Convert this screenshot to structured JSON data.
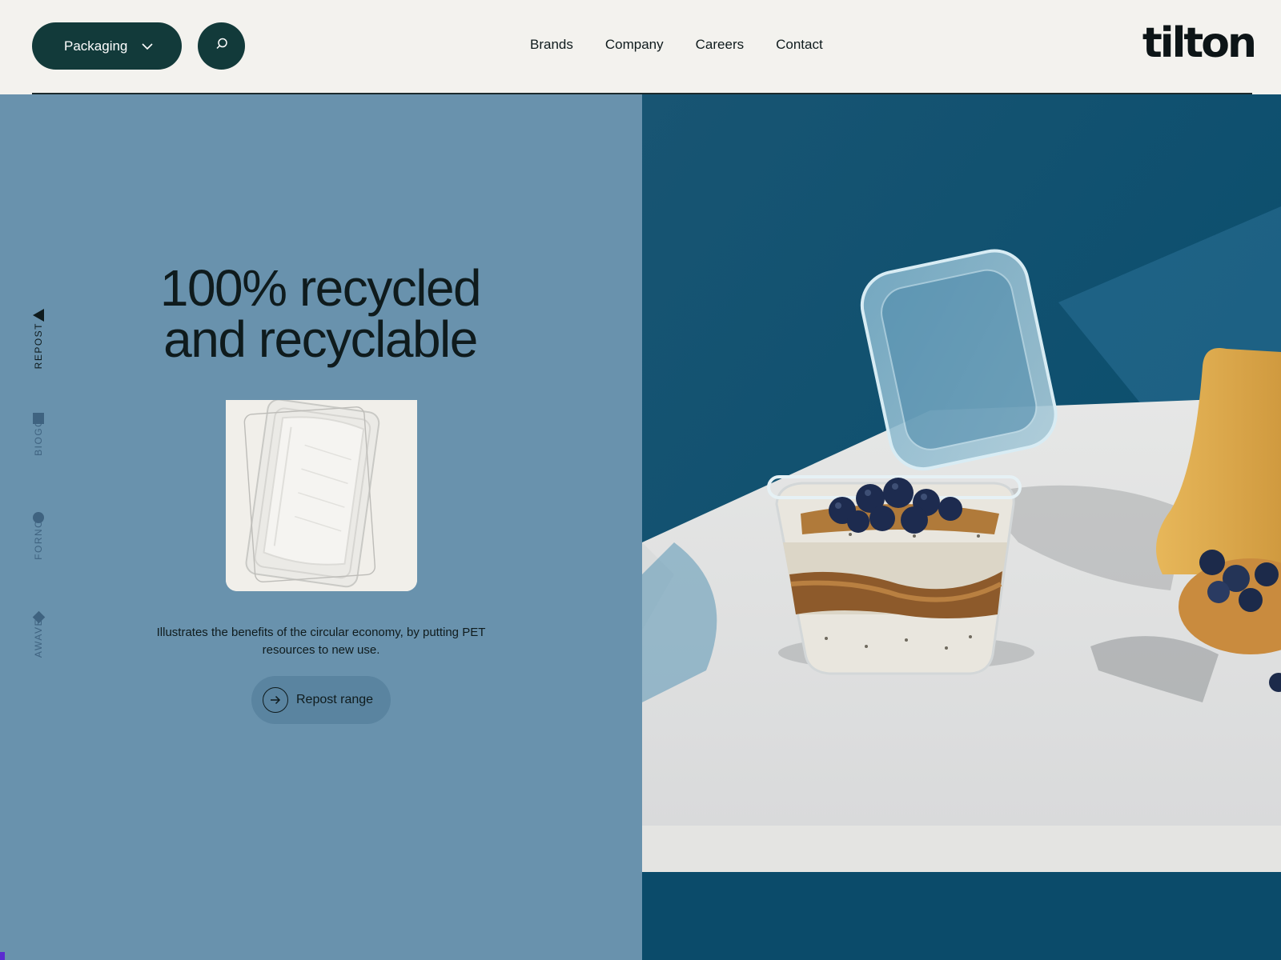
{
  "header": {
    "category_label": "Packaging",
    "nav": [
      "Brands",
      "Company",
      "Careers",
      "Contact"
    ],
    "logo_text": "tilton"
  },
  "sidebar": {
    "items": [
      {
        "label": "REPOST",
        "shape": "triangle",
        "active": true
      },
      {
        "label": "BIOGO",
        "shape": "square",
        "active": false
      },
      {
        "label": "FORNO",
        "shape": "circle",
        "active": false
      },
      {
        "label": "AWAVE",
        "shape": "diamond",
        "active": false
      }
    ]
  },
  "hero": {
    "headline_line1": "100% recycled",
    "headline_line2": "and recyclable",
    "description": "Illustrates the benefits of the circular economy, by putting PET resources to new use.",
    "cta_label": "Repost range"
  },
  "colors": {
    "panel_blue": "#6992ad",
    "dark_green": "#123a3a",
    "photo_bg": "#0f5576"
  },
  "icons": {
    "chevron": "chevron-down-icon",
    "search": "search-icon",
    "arrow": "arrow-right-circle-icon"
  }
}
